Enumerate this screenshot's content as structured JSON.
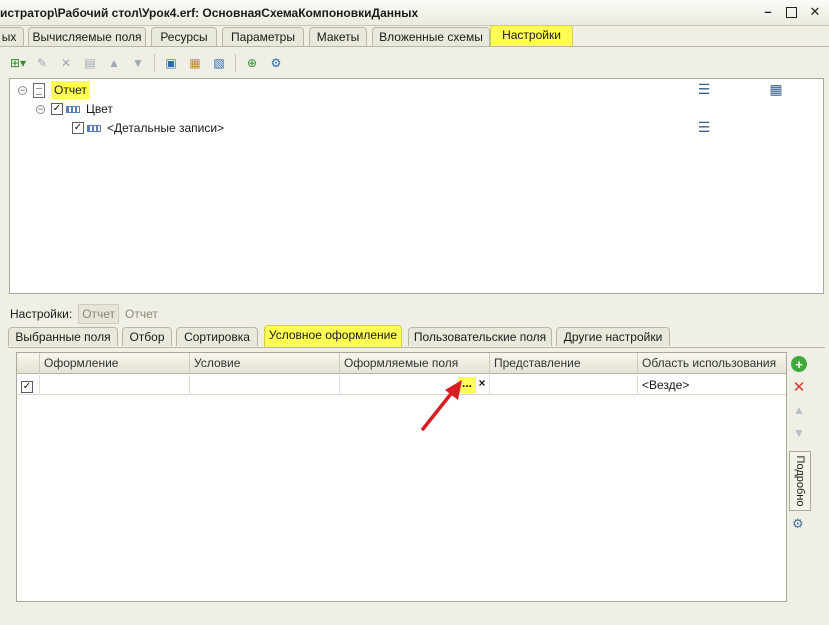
{
  "window": {
    "title": "истратор\\Рабочий стол\\Урок4.erf: ОсновнаяСхемаКомпоновкиДанных",
    "minimize_label": "–",
    "close_label": "✕"
  },
  "top_tabs": [
    {
      "label": "ых"
    },
    {
      "label": "Вычисляемые поля"
    },
    {
      "label": "Ресурсы"
    },
    {
      "label": "Параметры"
    },
    {
      "label": "Макеты"
    },
    {
      "label": "Вложенные схемы"
    },
    {
      "label": "Настройки",
      "active": true
    }
  ],
  "toolbar": {
    "icons": [
      "add-grouping-icon",
      "edit-icon",
      "delete-icon",
      "properties-icon",
      "move-up-icon",
      "move-down-icon",
      "find-icon",
      "group-icon",
      "ungroup-icon",
      "add-field-icon",
      "settings-icon"
    ]
  },
  "tree": {
    "root": "Отчет",
    "child": "Цвет",
    "grandchild": "<Детальные записи>"
  },
  "settings_bar": {
    "label": "Настройки:",
    "button": "Отчет",
    "value": "Отчет"
  },
  "sub_tabs": [
    {
      "label": "Выбранные поля"
    },
    {
      "label": "Отбор"
    },
    {
      "label": "Сортировка"
    },
    {
      "label": "Условное оформление",
      "active": true
    },
    {
      "label": "Пользовательские поля"
    },
    {
      "label": "Другие настройки"
    }
  ],
  "grid": {
    "columns": [
      "Оформление",
      "Условие",
      "Оформляемые поля",
      "Представление",
      "Область использования"
    ],
    "rows": [
      {
        "checked": true,
        "formatting": "",
        "condition": "",
        "fields": "",
        "presentation": "",
        "area": "<Везде>"
      }
    ],
    "dots_button": "...",
    "clear_button": "×"
  },
  "side_panel": {
    "add": "+",
    "delete": "✕",
    "up": "▲",
    "down": "▼",
    "details_label": "Подробно"
  },
  "colors": {
    "highlight": "#ffff55",
    "annotation_arrow": "#d91c24"
  }
}
